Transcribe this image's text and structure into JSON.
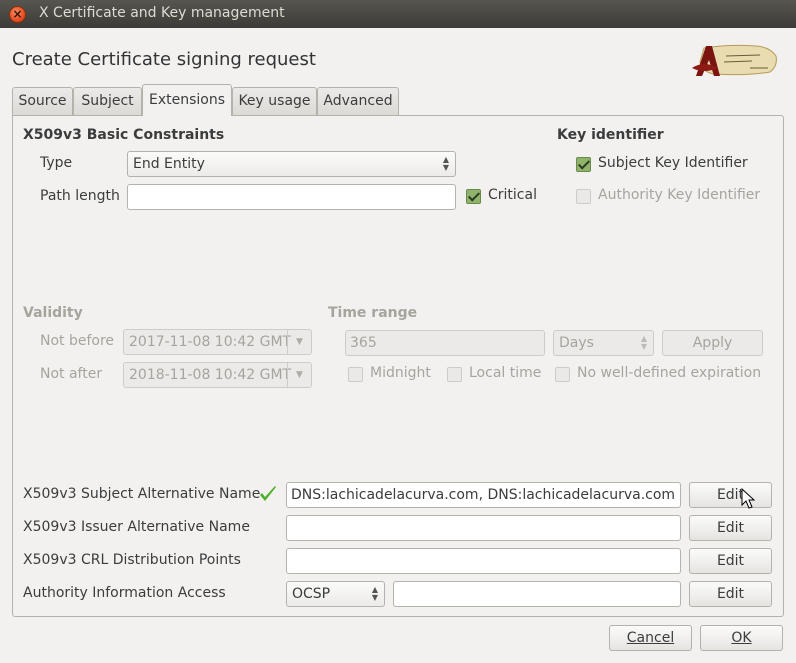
{
  "window": {
    "title": "X Certificate and Key management",
    "close_glyph": "×"
  },
  "dialog": {
    "heading": "Create Certificate signing request"
  },
  "tabs": [
    {
      "label": "Source"
    },
    {
      "label": "Subject"
    },
    {
      "label": "Extensions"
    },
    {
      "label": "Key usage"
    },
    {
      "label": "Advanced"
    }
  ],
  "basic_constraints": {
    "heading": "X509v3 Basic Constraints",
    "type_label": "Type",
    "type_value": "End Entity",
    "path_length_label": "Path length",
    "path_length_value": "",
    "critical_label": "Critical"
  },
  "key_identifier": {
    "heading": "Key identifier",
    "subject_label": "Subject Key Identifier",
    "authority_label": "Authority Key Identifier"
  },
  "validity": {
    "heading": "Validity",
    "not_before_label": "Not before",
    "not_before_value": "2017-11-08 10:42 GMT",
    "not_after_label": "Not after",
    "not_after_value": "2018-11-08 10:42 GMT"
  },
  "time_range": {
    "heading": "Time range",
    "amount": "365",
    "unit": "Days",
    "apply_label": "Apply",
    "midnight_label": "Midnight",
    "local_time_label": "Local time",
    "no_expiration_label": "No well-defined expiration"
  },
  "extensions": {
    "san_label": "X509v3 Subject Alternative Name",
    "san_value": "DNS:lachicadelacurva.com, DNS:lachicadelacurva.com",
    "ian_label": "X509v3 Issuer Alternative Name",
    "ian_value": "",
    "crl_label": "X509v3 CRL Distribution Points",
    "crl_value": "",
    "aia_label": "Authority Information Access",
    "aia_method": "OCSP",
    "aia_value": "",
    "edit_label": "Edit"
  },
  "footer": {
    "cancel_label": "Cancel",
    "ok_label": "OK"
  },
  "colors": {
    "check_green": "#4caf2a",
    "title_bar": "#3c3b37",
    "close_button": "#e0481b"
  }
}
